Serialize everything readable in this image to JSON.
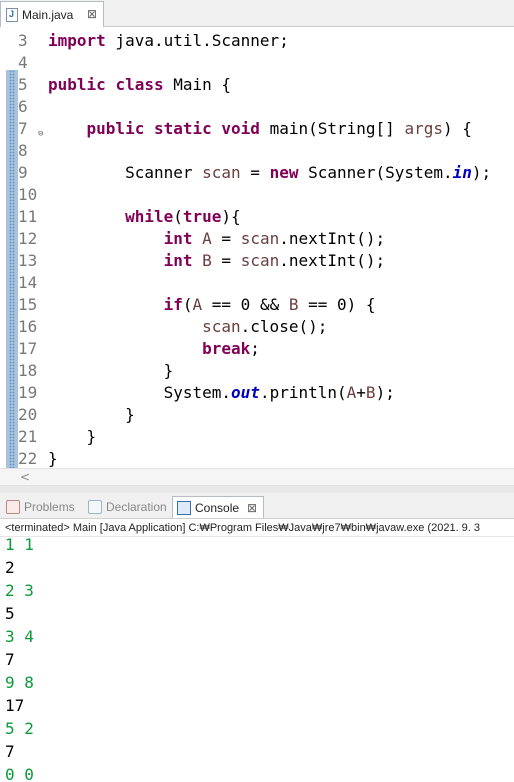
{
  "editor_tab": {
    "title": "Main.java",
    "close": "⊠"
  },
  "code_lines": [
    {
      "num": "3",
      "tokens": [
        {
          "k": "kw",
          "t": "import"
        },
        {
          "k": "p",
          "t": " java.util.Scanner;"
        }
      ]
    },
    {
      "num": "4",
      "tokens": []
    },
    {
      "num": "5",
      "tokens": [
        {
          "k": "kw",
          "t": "public"
        },
        {
          "k": "p",
          "t": " "
        },
        {
          "k": "kw",
          "t": "class"
        },
        {
          "k": "p",
          "t": " Main {"
        }
      ]
    },
    {
      "num": "6",
      "tokens": []
    },
    {
      "num": "7",
      "fold": true,
      "tokens": [
        {
          "k": "p",
          "t": "    "
        },
        {
          "k": "kw",
          "t": "public"
        },
        {
          "k": "p",
          "t": " "
        },
        {
          "k": "kw",
          "t": "static"
        },
        {
          "k": "p",
          "t": " "
        },
        {
          "k": "kw",
          "t": "void"
        },
        {
          "k": "p",
          "t": " main(String[] "
        },
        {
          "k": "var",
          "t": "args"
        },
        {
          "k": "p",
          "t": ") {"
        }
      ]
    },
    {
      "num": "8",
      "tokens": []
    },
    {
      "num": "9",
      "tokens": [
        {
          "k": "p",
          "t": "        Scanner "
        },
        {
          "k": "var",
          "t": "scan"
        },
        {
          "k": "p",
          "t": " = "
        },
        {
          "k": "kw",
          "t": "new"
        },
        {
          "k": "p",
          "t": " Scanner(System."
        },
        {
          "k": "fld",
          "t": "in"
        },
        {
          "k": "p",
          "t": ");"
        }
      ]
    },
    {
      "num": "10",
      "tokens": []
    },
    {
      "num": "11",
      "tokens": [
        {
          "k": "p",
          "t": "        "
        },
        {
          "k": "kw",
          "t": "while"
        },
        {
          "k": "p",
          "t": "("
        },
        {
          "k": "kw",
          "t": "true"
        },
        {
          "k": "p",
          "t": "){"
        }
      ]
    },
    {
      "num": "12",
      "tokens": [
        {
          "k": "p",
          "t": "            "
        },
        {
          "k": "kw",
          "t": "int"
        },
        {
          "k": "p",
          "t": " "
        },
        {
          "k": "var",
          "t": "A"
        },
        {
          "k": "p",
          "t": " = "
        },
        {
          "k": "var",
          "t": "scan"
        },
        {
          "k": "p",
          "t": ".nextInt();"
        }
      ]
    },
    {
      "num": "13",
      "tokens": [
        {
          "k": "p",
          "t": "            "
        },
        {
          "k": "kw",
          "t": "int"
        },
        {
          "k": "p",
          "t": " "
        },
        {
          "k": "var",
          "t": "B"
        },
        {
          "k": "p",
          "t": " = "
        },
        {
          "k": "var",
          "t": "scan"
        },
        {
          "k": "p",
          "t": ".nextInt();"
        }
      ]
    },
    {
      "num": "14",
      "tokens": []
    },
    {
      "num": "15",
      "tokens": [
        {
          "k": "p",
          "t": "            "
        },
        {
          "k": "kw",
          "t": "if"
        },
        {
          "k": "p",
          "t": "("
        },
        {
          "k": "var",
          "t": "A"
        },
        {
          "k": "p",
          "t": " == 0 && "
        },
        {
          "k": "var",
          "t": "B"
        },
        {
          "k": "p",
          "t": " == 0) {"
        }
      ]
    },
    {
      "num": "16",
      "tokens": [
        {
          "k": "p",
          "t": "                "
        },
        {
          "k": "var",
          "t": "scan"
        },
        {
          "k": "p",
          "t": ".close();"
        }
      ]
    },
    {
      "num": "17",
      "tokens": [
        {
          "k": "p",
          "t": "                "
        },
        {
          "k": "kw",
          "t": "break"
        },
        {
          "k": "p",
          "t": ";"
        }
      ]
    },
    {
      "num": "18",
      "tokens": [
        {
          "k": "p",
          "t": "            }"
        }
      ]
    },
    {
      "num": "19",
      "tokens": [
        {
          "k": "p",
          "t": "            System."
        },
        {
          "k": "fld",
          "t": "out"
        },
        {
          "k": "p",
          "t": ".println("
        },
        {
          "k": "var",
          "t": "A"
        },
        {
          "k": "p",
          "t": "+"
        },
        {
          "k": "var",
          "t": "B"
        },
        {
          "k": "p",
          "t": ");"
        }
      ]
    },
    {
      "num": "20",
      "tokens": [
        {
          "k": "p",
          "t": "        }"
        }
      ]
    },
    {
      "num": "21",
      "tokens": [
        {
          "k": "p",
          "t": "    }"
        }
      ]
    },
    {
      "num": "22",
      "tokens": [
        {
          "k": "p",
          "t": "}"
        }
      ]
    }
  ],
  "view_tabs": {
    "problems": "Problems",
    "declaration": "Declaration",
    "console": "Console",
    "console_close": "⊠"
  },
  "console_header": "<terminated> Main [Java Application] C:₩Program Files₩Java₩jre7₩bin₩javaw.exe (2021. 9. 3",
  "console_lines": [
    {
      "text": "1 1",
      "type": "in"
    },
    {
      "text": "2",
      "type": "out"
    },
    {
      "text": "2 3",
      "type": "in"
    },
    {
      "text": "5",
      "type": "out"
    },
    {
      "text": "3 4",
      "type": "in"
    },
    {
      "text": "7",
      "type": "out"
    },
    {
      "text": "9 8",
      "type": "in"
    },
    {
      "text": "17",
      "type": "out"
    },
    {
      "text": "5 2",
      "type": "in"
    },
    {
      "text": "7",
      "type": "out"
    },
    {
      "text": "0 0",
      "type": "in"
    }
  ],
  "colors": {
    "keyword": "#7f0055",
    "field": "#0000c0",
    "variable": "#6a3e3e",
    "console_input": "#0a9a3a",
    "line_number": "#787878"
  },
  "icons": {
    "editor_tab": "java-file-icon",
    "problems": "problems-icon",
    "declaration": "declaration-icon",
    "console": "console-icon"
  }
}
